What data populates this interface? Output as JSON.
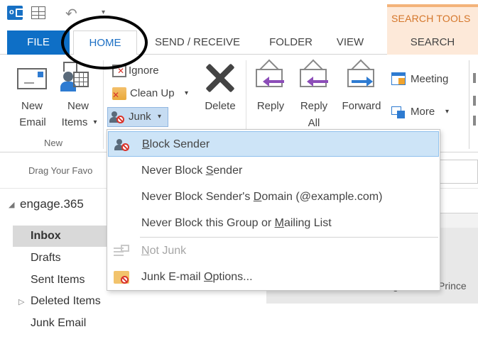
{
  "context_tab_group": "SEARCH TOOLS",
  "tabs": {
    "file": "FILE",
    "home": "HOME",
    "send_receive": "SEND / RECEIVE",
    "folder": "FOLDER",
    "view": "VIEW",
    "search": "SEARCH"
  },
  "ribbon": {
    "new_email": [
      "New",
      "Email"
    ],
    "new_items": [
      "New",
      "Items"
    ],
    "new_group_label": "New",
    "ignore": "Ignore",
    "clean_up": "Clean Up",
    "junk": "Junk",
    "delete": "Delete",
    "reply": "Reply",
    "reply_all": [
      "Reply",
      "All"
    ],
    "forward": "Forward",
    "meeting": "Meeting",
    "more": "More"
  },
  "favorites_hint": "Drag Your Favo",
  "nav": {
    "account": "engage.365",
    "folders": [
      "Inbox",
      "Drafts",
      "Sent Items",
      "Deleted Items",
      "Junk Email"
    ]
  },
  "list_preview": {
    "fragment_left": "g",
    "fragment_right": "R Prince"
  },
  "junk_menu": {
    "block_sender": {
      "pre": "",
      "key": "B",
      "post": "lock Sender"
    },
    "never_block_sender": {
      "pre": "Never Block ",
      "key": "S",
      "post": "ender"
    },
    "never_block_domain": {
      "pre": "Never Block Sender's ",
      "key": "D",
      "post": "omain (@example.com)"
    },
    "never_block_group": {
      "pre": "Never Block this Group or ",
      "key": "M",
      "post": "ailing List"
    },
    "not_junk": {
      "pre": "",
      "key": "N",
      "post": "ot Junk"
    },
    "junk_options": {
      "pre": "Junk E-mail ",
      "key": "O",
      "post": "ptions..."
    }
  },
  "colors": {
    "file_tab": "#0e6fc6",
    "accent_blue": "#1c6fc4",
    "context_orange": "#d4762a",
    "menu_highlight": "#cde4f7",
    "junk_red": "#d9332b"
  }
}
